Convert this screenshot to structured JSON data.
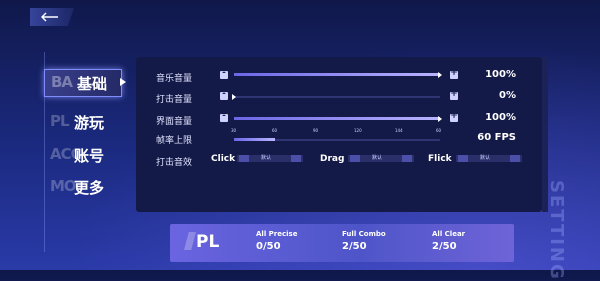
{
  "header": {
    "back_icon": "back-arrow-icon"
  },
  "tabs": [
    {
      "shadow": "BA",
      "label": "基础",
      "active": true
    },
    {
      "shadow": "PL",
      "label": "游玩",
      "active": false
    },
    {
      "shadow": "ACC",
      "label": "账号",
      "active": false
    },
    {
      "shadow": "MO",
      "label": "更多",
      "active": false
    }
  ],
  "settings": {
    "music_volume": {
      "label": "音乐音量",
      "value": "100%",
      "level": 1.0
    },
    "hit_volume": {
      "label": "打击音量",
      "value": "0%",
      "level": 0.0
    },
    "ui_volume": {
      "label": "界面音量",
      "value": "100%",
      "level": 1.0
    },
    "frame_limit": {
      "label": "帧率上限",
      "value": "60 FPS",
      "ticks": [
        "30",
        "60",
        "90",
        "120",
        "144",
        "60"
      ],
      "level": 0.2
    },
    "hit_sound": {
      "label": "打击音效"
    },
    "minus": "-",
    "plus": "+"
  },
  "hit_sounds": [
    {
      "name": "Click",
      "option": "默认"
    },
    {
      "name": "Drag",
      "option": "默认"
    },
    {
      "name": "Flick",
      "option": "默认"
    }
  ],
  "summary": {
    "logo": "PL",
    "all_precise_label": "All Precise",
    "all_precise_value": "0/50",
    "full_combo_label": "Full Combo",
    "full_combo_value": "2/50",
    "all_clear_label": "All Clear",
    "all_clear_value": "2/50"
  },
  "watermark": "SETTING",
  "colors": {
    "accent": "#8f8aff",
    "panel": "#141a48",
    "highlight": "#ff6fb0"
  }
}
